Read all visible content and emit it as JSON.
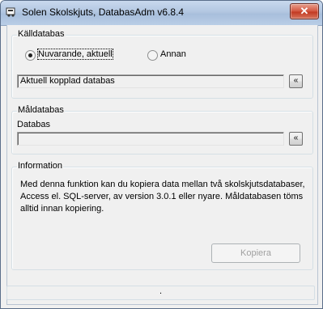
{
  "window": {
    "title": "Solen Skolskjuts, DatabasAdm v6.8.4",
    "close_label": "✕"
  },
  "source_group": {
    "legend": "Källdatabas",
    "radio_current_label": "Nuvarande, aktuell",
    "radio_other_label": "Annan",
    "selected": "current",
    "db_field_value": "Aktuell kopplad databas",
    "browse_label": "«"
  },
  "target_group": {
    "legend": "Måldatabas",
    "field_label": "Databas",
    "db_field_value": "",
    "browse_label": "«"
  },
  "info_group": {
    "legend": "Information",
    "text": "Med denna funktion kan du kopiera data mellan två skolskjutsdatabaser, Access el. SQL-server, av version 3.0.1 eller nyare. Måldatabasen töms alltid innan kopiering."
  },
  "copy_button_label": "Kopiera",
  "status_text": "."
}
